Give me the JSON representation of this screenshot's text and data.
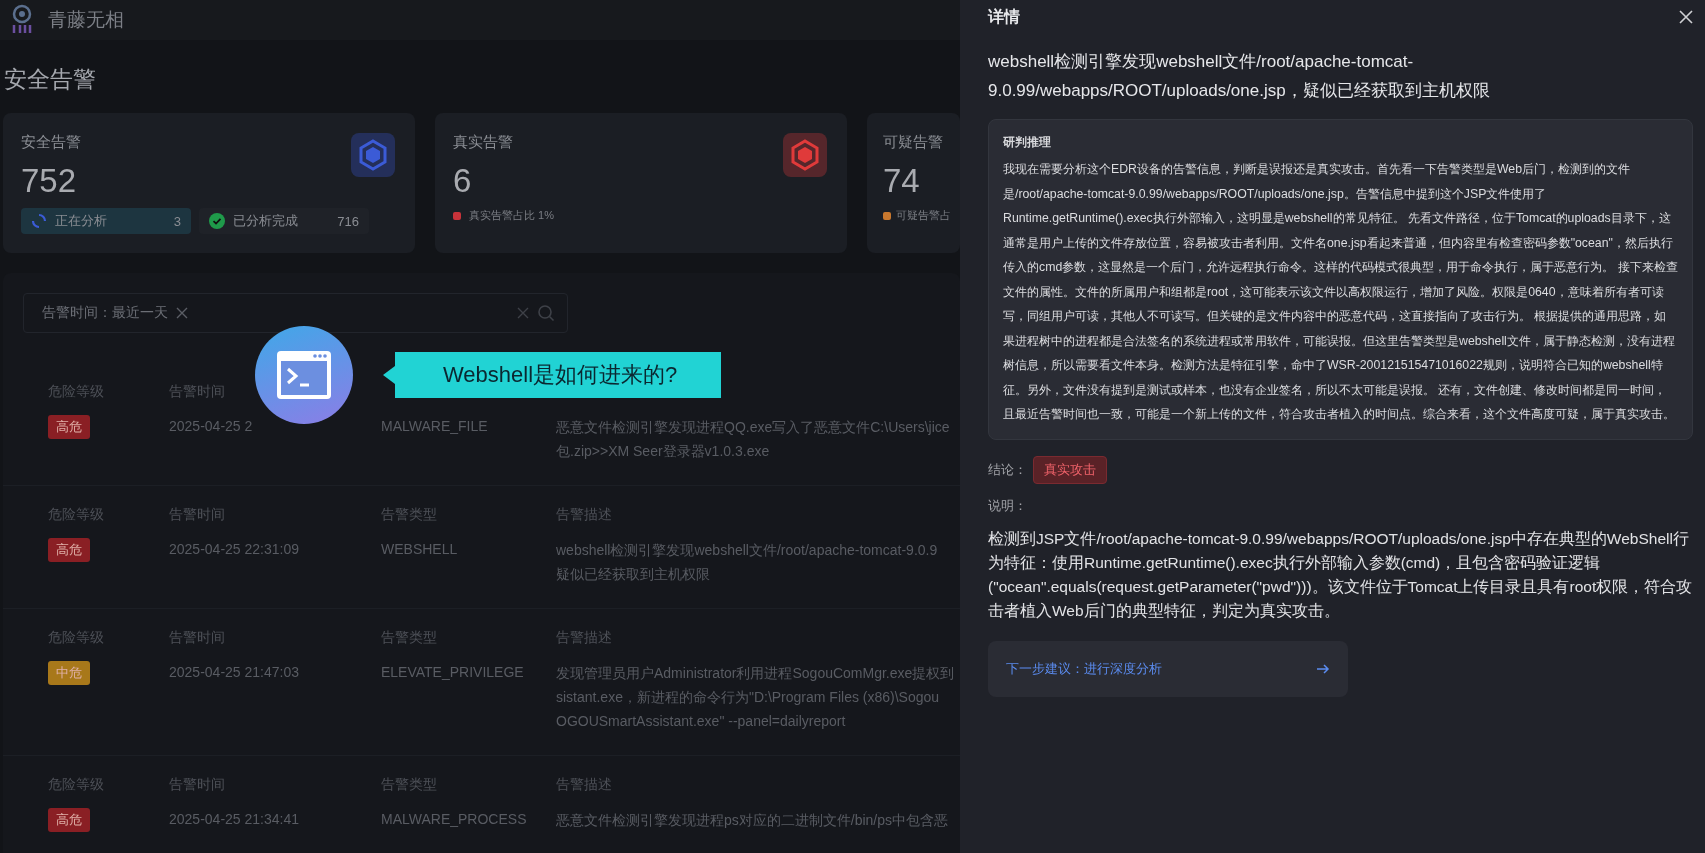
{
  "app": {
    "name": "青藤无相"
  },
  "page_title": "安全告警",
  "stat_cards": [
    {
      "title": "安全告警",
      "value": "752",
      "color": "#3b5bd6",
      "progress": [
        {
          "kind": "analyzing",
          "label": "正在分析",
          "count": "3"
        },
        {
          "kind": "done",
          "label": "已分析完成",
          "count": "716"
        }
      ]
    },
    {
      "title": "真实告警",
      "value": "6",
      "color": "#e03a3a",
      "legend": {
        "label": "真实告警占比 1%",
        "color": "#c7333a"
      }
    },
    {
      "title": "可疑告警",
      "value": "74",
      "legend": {
        "label": "可疑告警占",
        "color": "#c8782e"
      }
    }
  ],
  "filter": {
    "tag": "告警时间：最近一天"
  },
  "rows": [
    {
      "level_header": "危险等级",
      "level": {
        "label": "高危",
        "color": "#8a1f24"
      },
      "time_header": "告警时间",
      "time": "2025-04-25 2",
      "type": "MALWARE_FILE",
      "desc_lines": [
        "恶意文件检测引擎发现进程QQ.exe写入了恶意文件C:\\Users\\jice",
        "包.zip>>XM Seer登录器v1.0.3.exe"
      ]
    },
    {
      "level_header": "危险等级",
      "level": {
        "label": "高危",
        "color": "#8a1f24"
      },
      "time_header": "告警时间",
      "time": "2025-04-25 22:31:09",
      "type_header": "告警类型",
      "type": "WEBSHELL",
      "desc_header": "告警描述",
      "desc_lines": [
        "webshell检测引擎发现webshell文件/root/apache-tomcat-9.0.9",
        "疑似已经获取到主机权限"
      ]
    },
    {
      "level_header": "危险等级",
      "level": {
        "label": "中危",
        "color": "#a8781a"
      },
      "time_header": "告警时间",
      "time": "2025-04-25 21:47:03",
      "type_header": "告警类型",
      "type": "ELEVATE_PRIVILEGE",
      "desc_header": "告警描述",
      "desc_lines": [
        "发现管理员用户Administrator利用进程SogouComMgr.exe提权到",
        "sistant.exe，新进程的命令行为\"D:\\Program Files (x86)\\Sogou",
        "OGOUSmartAssistant.exe\" --panel=dailyreport"
      ]
    },
    {
      "level_header": "危险等级",
      "level": {
        "label": "高危",
        "color": "#8a1f24"
      },
      "time_header": "告警时间",
      "time": "2025-04-25 21:34:41",
      "type_header": "告警类型",
      "type": "MALWARE_PROCESS",
      "desc_header": "告警描述",
      "desc_lines": [
        "恶意文件检测引擎发现进程ps对应的二进制文件/bin/ps中包含恶"
      ]
    }
  ],
  "callout": {
    "text": "Webshell是如何进来的?"
  },
  "drawer": {
    "title": "详情",
    "headline": "webshell检测引擎发现webshell文件/root/apache-tomcat-9.0.99/webapps/ROOT/uploads/one.jsp，疑似已经获取到主机权限",
    "reasoning": {
      "title": "研判推理",
      "text": "我现在需要分析这个EDR设备的告警信息，判断是误报还是真实攻击。首先看一下告警类型是Web后门，检测到的文件是/root/apache-tomcat-9.0.99/webapps/ROOT/uploads/one.jsp。告警信息中提到这个JSP文件使用了Runtime.getRuntime().exec执行外部输入，这明显是webshell的常见特征。 先看文件路径，位于Tomcat的uploads目录下，这通常是用户上传的文件存放位置，容易被攻击者利用。文件名one.jsp看起来普通，但内容里有检查密码参数\"ocean\"，然后执行传入的cmd参数，这显然是一个后门，允许远程执行命令。这样的代码模式很典型，用于命令执行，属于恶意行为。 接下来检查文件的属性。文件的所属用户和组都是root，这可能表示该文件以高权限运行，增加了风险。权限是0640，意味着所有者可读写，同组用户可读，其他人不可读写。但关键的是文件内容中的恶意代码，这直接指向了攻击行为。 根据提供的通用思路，如果进程树中的进程都是合法签名的系统进程或常用软件，可能误报。但这里告警类型是webshell文件，属于静态检测，没有进程树信息，所以需要看文件本身。检测方法是特征引擎，命中了WSR-200121515471016022规则，说明符合已知的webshell特征。另外，文件没有提到是测试或样本，也没有企业签名，所以不太可能是误报。 还有，文件创建、修改时间都是同一时间，且最近告警时间也一致，可能是一个新上传的文件，符合攻击者植入的时间点。综合来看，这个文件高度可疑，属于真实攻击。"
    },
    "conclusion": {
      "label": "结论：",
      "verdict": "真实攻击"
    },
    "explanation": {
      "label": "说明：",
      "text": "检测到JSP文件/root/apache-tomcat-9.0.99/webapps/ROOT/uploads/one.jsp中存在典型的WebShell行为特征：使用Runtime.getRuntime().exec执行外部输入参数(cmd)，且包含密码验证逻辑(\"ocean\".equals(request.getParameter(\"pwd\")))。该文件位于Tomcat上传目录且具有root权限，符合攻击者植入Web后门的典型特征，判定为真实攻击。"
    },
    "next_step": "下一步建议：进行深度分析"
  }
}
